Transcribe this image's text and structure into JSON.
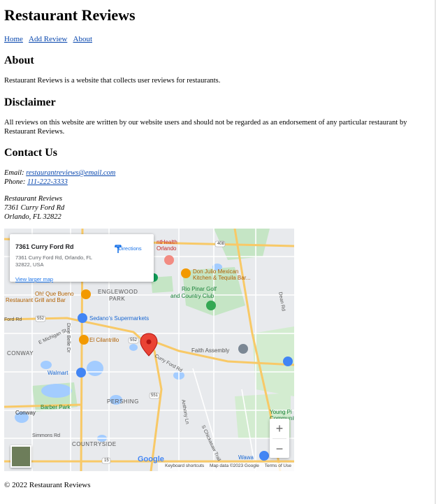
{
  "site_title": "Restaurant Reviews",
  "nav": {
    "home": "Home",
    "add_review": "Add Review",
    "about": "About"
  },
  "about": {
    "heading": "About",
    "text": "Restaurant Reviews is a website that collects user reviews for restaurants."
  },
  "disclaimer": {
    "heading": "Disclaimer",
    "text": "All reviews on this website are written by our website users and should not be regarded as an endorsement of any particular restaurant by Restaurant Reviews."
  },
  "contact": {
    "heading": "Contact Us",
    "email_label": "Email:",
    "email": "restaurantreviews@email.com",
    "phone_label": "Phone:",
    "phone": "111-222-3333",
    "address_name": "Restaurant Reviews",
    "address_line1": "7361 Curry Ford Rd",
    "address_line2": "Orlando, FL 32822"
  },
  "map": {
    "card_title": "7361 Curry Ford Rd",
    "card_address": "7361 Curry Ford Rd, Orlando, FL 32822, USA",
    "directions": "Directions",
    "view_larger": "View larger map",
    "zoom_in": "+",
    "zoom_out": "−",
    "attribution_shortcuts": "Keyboard shortcuts",
    "attribution_data": "Map data ©2023 Google",
    "attribution_terms": "Terms of Use",
    "google": "Google",
    "labels": {
      "adventhealth": "ntHealth",
      "orlando": "Orlando",
      "don_julio": "Don Julio Mexican",
      "don_julio_2": "Kitchen & Tequila Bar...",
      "rio_pinar": "Rio Pinar Golf",
      "rio_pinar_2": "and Country Club",
      "oh_que_bueno": "Oh! Que Bueno",
      "oh_que_bueno_2": "Restaurant Grill and Bar",
      "englewood": "ENGLEWOOD",
      "park": "PARK",
      "sedanos": "Sedano's Supermarkets",
      "el_cilantrillo": "El Cilantrillo",
      "faith_assembly": "Faith Assembly",
      "conway_caps": "CONWAY",
      "walmart": "Walmart",
      "pershing": "PERSHING",
      "barber_park": "Barber Park",
      "conway": "Conway",
      "young_pine": "Young Pi",
      "community": "Communit",
      "countryside": "COUNTRYSIDE",
      "wawa": "Wawa",
      "curry_ford": "Curry Ford Rd",
      "ford_rd": "Ford Rd",
      "dixie_belle": "Dixie Belle Dr",
      "michigan": "E Michigan St",
      "simmons": "Simmons Rd",
      "anthony": "Anthony Ln",
      "chickasaw": "S Chickasaw Trail",
      "dean": "Dean Rd",
      "r552": "552",
      "r551": "551",
      "r15": "15",
      "r408": "408"
    }
  },
  "footer": "© 2022 Restaurant Reviews",
  "colors": {
    "link": "#0645ad",
    "map_bg": "#e8eaed",
    "road_major": "#f8c967",
    "road_minor": "#ffffff",
    "park": "#c5e5c5",
    "water": "#a3ccff",
    "pin": "#ea4335"
  }
}
